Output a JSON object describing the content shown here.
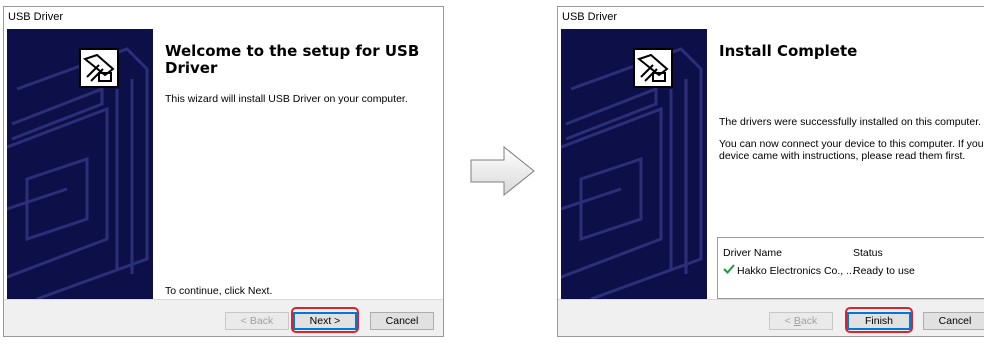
{
  "left_dialog": {
    "title": "USB Driver",
    "heading": "Welcome to the setup for USB Driver",
    "body": "This wizard will install USB Driver on your computer.",
    "footer_text": "To continue, click Next.",
    "buttons": {
      "back": "< Back",
      "next": "Next >",
      "cancel": "Cancel"
    },
    "highlighted_button": "next"
  },
  "right_dialog": {
    "title": "USB Driver",
    "heading": "Install Complete",
    "body1": "The drivers were successfully installed on this computer.",
    "body2": "You can now connect your device to this computer. If your device came with instructions, please read them first.",
    "table": {
      "headers": [
        "Driver Name",
        "Status"
      ],
      "rows": [
        {
          "name": "Hakko Electronics Co., ...",
          "status": "Ready to use",
          "icon": "checkmark-icon"
        }
      ]
    },
    "buttons": {
      "back_prefix": "< ",
      "back_mnemonic": "B",
      "back_rest": "ack",
      "finish": "Finish",
      "cancel": "Cancel"
    },
    "highlighted_button": "finish"
  },
  "between": {
    "icon": "right-arrow-icon"
  },
  "colors": {
    "side_panel": "#0d0f48",
    "highlight": "#e0202b",
    "default_button": "#0078d7",
    "check": "#1e9a3a"
  }
}
